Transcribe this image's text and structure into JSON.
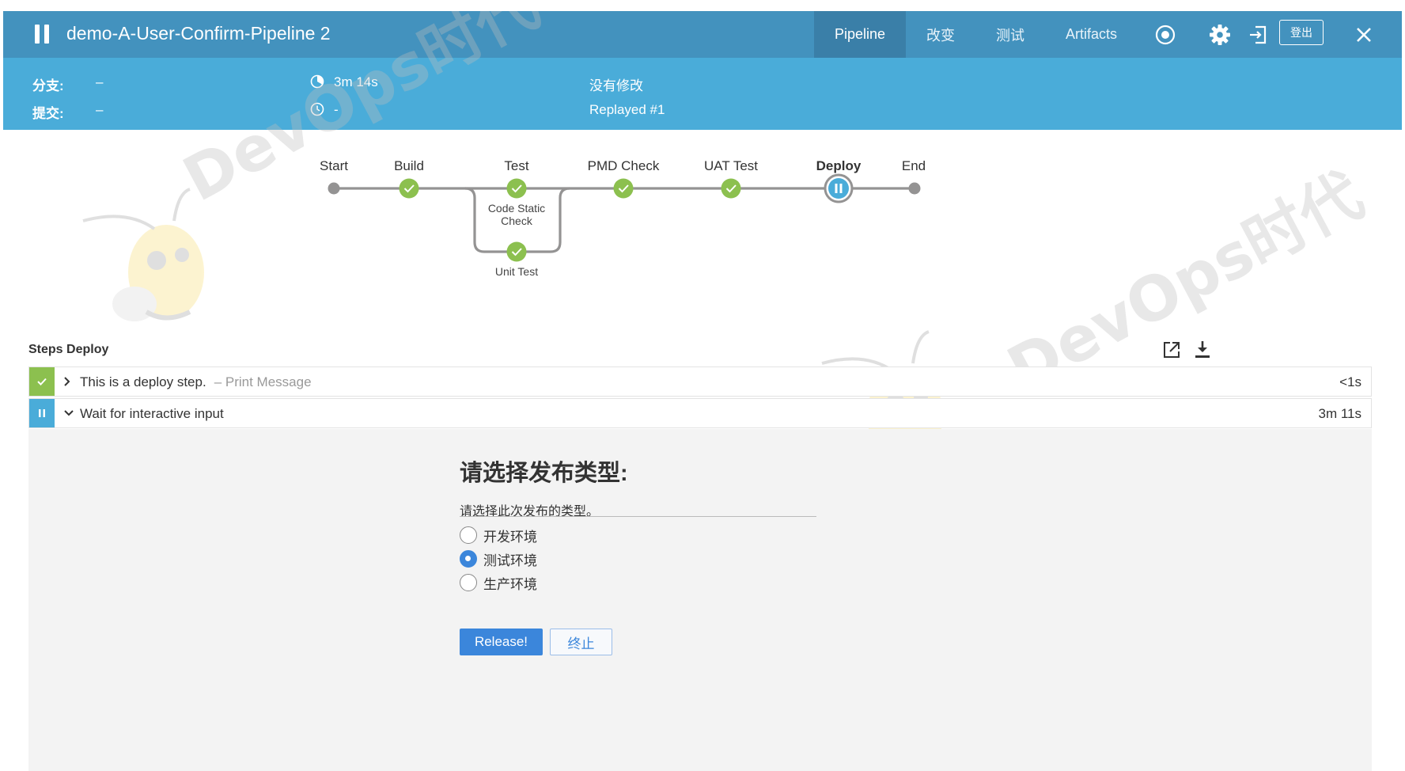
{
  "header": {
    "run_title": "demo-A-User-Confirm-Pipeline 2",
    "tabs": [
      {
        "label": "Pipeline",
        "active": true
      },
      {
        "label": "改变",
        "active": false
      },
      {
        "label": "测试",
        "active": false
      },
      {
        "label": "Artifacts",
        "active": false
      }
    ],
    "icons": [
      "stop-icon",
      "gear-icon",
      "exit-icon"
    ],
    "logout_label": "登出",
    "close_icon": "close-icon"
  },
  "summary": {
    "branch_label": "分支:",
    "branch_value": "–",
    "commit_label": "提交:",
    "commit_value": "–",
    "duration": "3m 14s",
    "started": "-",
    "changes": "没有修改",
    "cause": "Replayed #1"
  },
  "pipeline": {
    "stages": [
      {
        "name": "Start",
        "status": "start"
      },
      {
        "name": "Build",
        "status": "success"
      },
      {
        "name": "Test",
        "status": "success",
        "parallel": [
          {
            "name": "Code Static\nCheck",
            "status": "success"
          },
          {
            "name": "Unit Test",
            "status": "success"
          }
        ]
      },
      {
        "name": "PMD Check",
        "status": "success"
      },
      {
        "name": "UAT Test",
        "status": "success"
      },
      {
        "name": "Deploy",
        "status": "paused",
        "selected": true
      },
      {
        "name": "End",
        "status": "end"
      }
    ],
    "parallel_labels": {
      "code_static_line1": "Code Static",
      "code_static_line2": "Check",
      "unit_test": "Unit Test"
    }
  },
  "watermark": "DevOps时代",
  "steps": {
    "title": "Steps Deploy",
    "icons": [
      "open-external-icon",
      "download-icon"
    ],
    "rows": [
      {
        "status": "success",
        "expanded": false,
        "title": "This is a deploy step.",
        "subtitle": "– Print Message",
        "duration": "<1s"
      },
      {
        "status": "paused",
        "expanded": true,
        "title": "Wait for interactive input",
        "subtitle": "",
        "duration": "3m 11s"
      }
    ]
  },
  "input": {
    "title": "请选择发布类型:",
    "description": "请选择此次发布的类型。",
    "options": [
      {
        "label": "开发环境",
        "selected": false
      },
      {
        "label": "测试环境",
        "selected": true
      },
      {
        "label": "生产环境",
        "selected": false
      }
    ],
    "submit_label": "Release!",
    "abort_label": "终止"
  },
  "colors": {
    "header": "#4392be",
    "subbar": "#4aacd9",
    "success": "#8cc04f",
    "paused": "#4aacd9",
    "primary_button": "#3b86db"
  }
}
